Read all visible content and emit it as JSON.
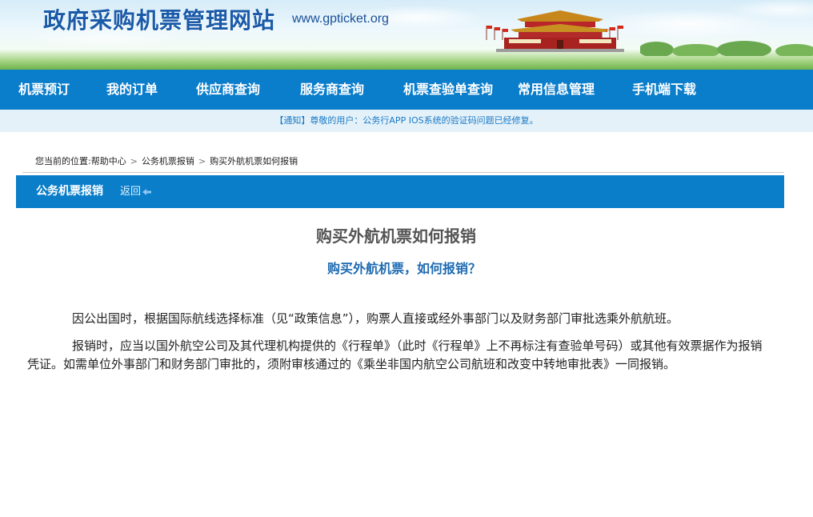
{
  "header": {
    "site_title": "政府采购机票管理网站",
    "site_url": "www.gpticket.org",
    "image_icon": "tiananmen-gate-icon"
  },
  "nav": {
    "items": [
      {
        "label": "机票预订"
      },
      {
        "label": "我的订单"
      },
      {
        "label": "供应商查询"
      },
      {
        "label": "服务商查询"
      },
      {
        "label": "机票查验单查询"
      },
      {
        "label": "常用信息管理"
      },
      {
        "label": "手机端下载"
      }
    ]
  },
  "notice": {
    "tag": "【通知】",
    "text": "尊敬的用户：公务行APP IOS系统的验证码问题已经修复。"
  },
  "breadcrumb": {
    "prefix": "您当前的位置:",
    "items": [
      "帮助中心",
      "公务机票报销",
      "购买外航机票如何报销"
    ],
    "separator": ">"
  },
  "section": {
    "title": "公务机票报销",
    "back_label": "返回",
    "back_icon": "back-arrow-icon"
  },
  "article": {
    "title": "购买外航机票如何报销",
    "subtitle": "购买外航机票，如何报销？",
    "paragraphs": [
      "因公出国时，根据国际航线选择标准（见“政策信息”），购票人直接或经外事部门以及财务部门审批选乘外航航班。",
      "报销时，应当以国外航空公司及其代理机构提供的《行程单》（此时《行程单》上不再标注有查验单号码）或其他有效票据作为报销凭证。如需单位外事部门和财务部门审批的，须附审核通过的《乘坐非国内航空公司航班和改变中转地审批表》一同报销。"
    ]
  },
  "colors": {
    "nav_bg": "#0a7dcb",
    "section_bar_bg": "#0b7ec9",
    "notice_bg": "#e4f1f8",
    "title_blue": "#1a5aa8",
    "subtitle_blue": "#1e6bb2"
  }
}
